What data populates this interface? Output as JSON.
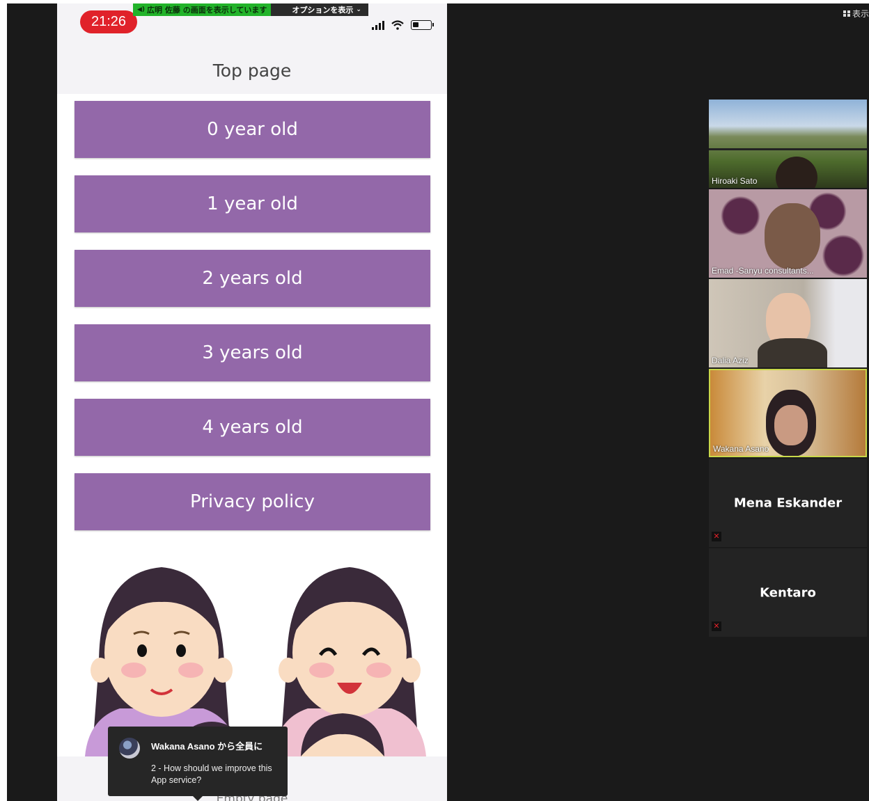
{
  "share_banner": {
    "status": "広明 佐藤 の画面を表示しています",
    "options": "オプションを表示"
  },
  "view_button": {
    "label": "表示"
  },
  "phone": {
    "clock": "21:26",
    "page_title": "Top page",
    "menu_items": [
      {
        "label": "0 year old"
      },
      {
        "label": "1 year old"
      },
      {
        "label": "2 years old"
      },
      {
        "label": "3 years old"
      },
      {
        "label": "4 years old"
      },
      {
        "label": "Privacy policy"
      }
    ],
    "button_color": "#9368a9",
    "footer_label": "Empty page"
  },
  "chat_popup": {
    "sender": "Wakana Asano から全員に",
    "message": "2 - How should we improve this App service?"
  },
  "participants": [
    {
      "name": "Hiroaki Sato",
      "has_video": true
    },
    {
      "name": "Emad -Sanyu consultants...",
      "has_video": true
    },
    {
      "name": "Dalia Aziz",
      "has_video": true
    },
    {
      "name": "Wakana Asano",
      "has_video": true,
      "active_speaker": true
    },
    {
      "name": "Mena Eskander",
      "has_video": false,
      "muted": true
    },
    {
      "name": "Kentaro",
      "has_video": false,
      "muted": true
    }
  ],
  "icons": [
    "speaker-icon",
    "chevron-down-icon",
    "grid-view-icon",
    "signal-icon",
    "wifi-icon",
    "battery-icon",
    "muted-mic-icon"
  ]
}
